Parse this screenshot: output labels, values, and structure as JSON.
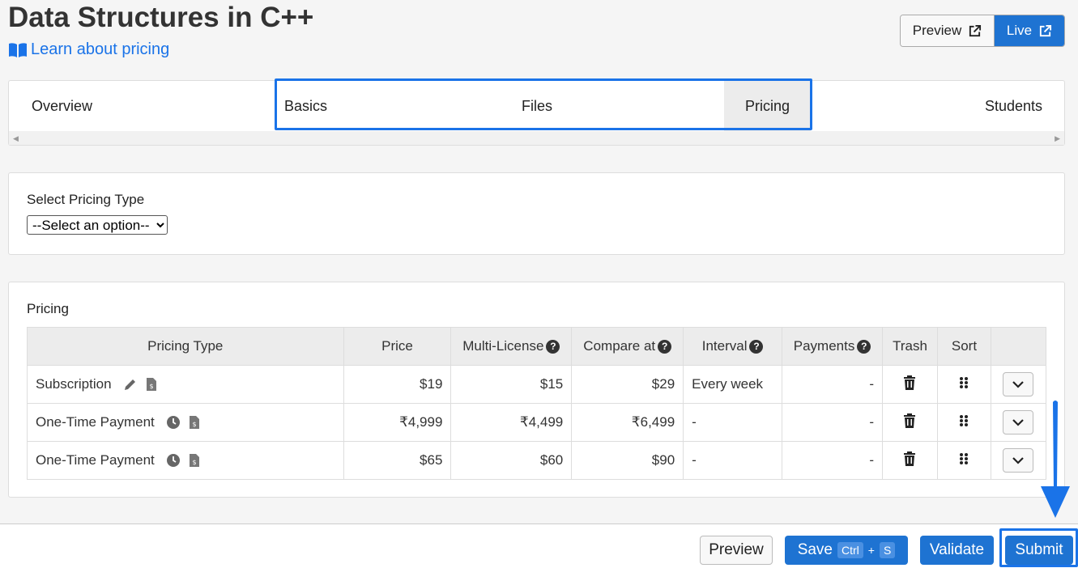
{
  "header": {
    "title": "Data Structures in C++",
    "learn_link": "Learn about pricing",
    "preview_label": "Preview",
    "live_label": "Live"
  },
  "tabs": [
    {
      "label": "Overview",
      "active": false
    },
    {
      "label": "Basics",
      "active": false
    },
    {
      "label": "Files",
      "active": false
    },
    {
      "label": "Pricing",
      "active": true
    },
    {
      "label": "Students",
      "active": false
    }
  ],
  "select_pricing": {
    "label": "Select Pricing Type",
    "selected": "--Select an option--"
  },
  "pricing": {
    "section_label": "Pricing",
    "columns": [
      "Pricing Type",
      "Price",
      "Multi-License",
      "Compare at",
      "Interval",
      "Payments",
      "Trash",
      "Sort",
      ""
    ],
    "rows": [
      {
        "type": "Subscription",
        "price": "$19",
        "multi_license": "$15",
        "compare_at": "$29",
        "interval": "Every week",
        "payments": "-",
        "icons": [
          "pencil-icon",
          "invoice-dollar-icon"
        ]
      },
      {
        "type": "One-Time Payment",
        "price": "₹4,999",
        "multi_license": "₹4,499",
        "compare_at": "₹6,499",
        "interval": "-",
        "payments": "-",
        "icons": [
          "clock-icon",
          "invoice-dollar-icon"
        ]
      },
      {
        "type": "One-Time Payment",
        "price": "$65",
        "multi_license": "$60",
        "compare_at": "$90",
        "interval": "-",
        "payments": "-",
        "icons": [
          "clock-icon",
          "invoice-dollar-icon"
        ]
      }
    ]
  },
  "footer": {
    "preview_label": "Preview",
    "save_label": "Save",
    "save_kbd_1": "Ctrl",
    "save_kbd_plus": "+",
    "save_kbd_2": "S",
    "validate_label": "Validate",
    "submit_label": "Submit"
  },
  "colors": {
    "accent": "#1e73d2",
    "highlight": "#1a73e8"
  }
}
